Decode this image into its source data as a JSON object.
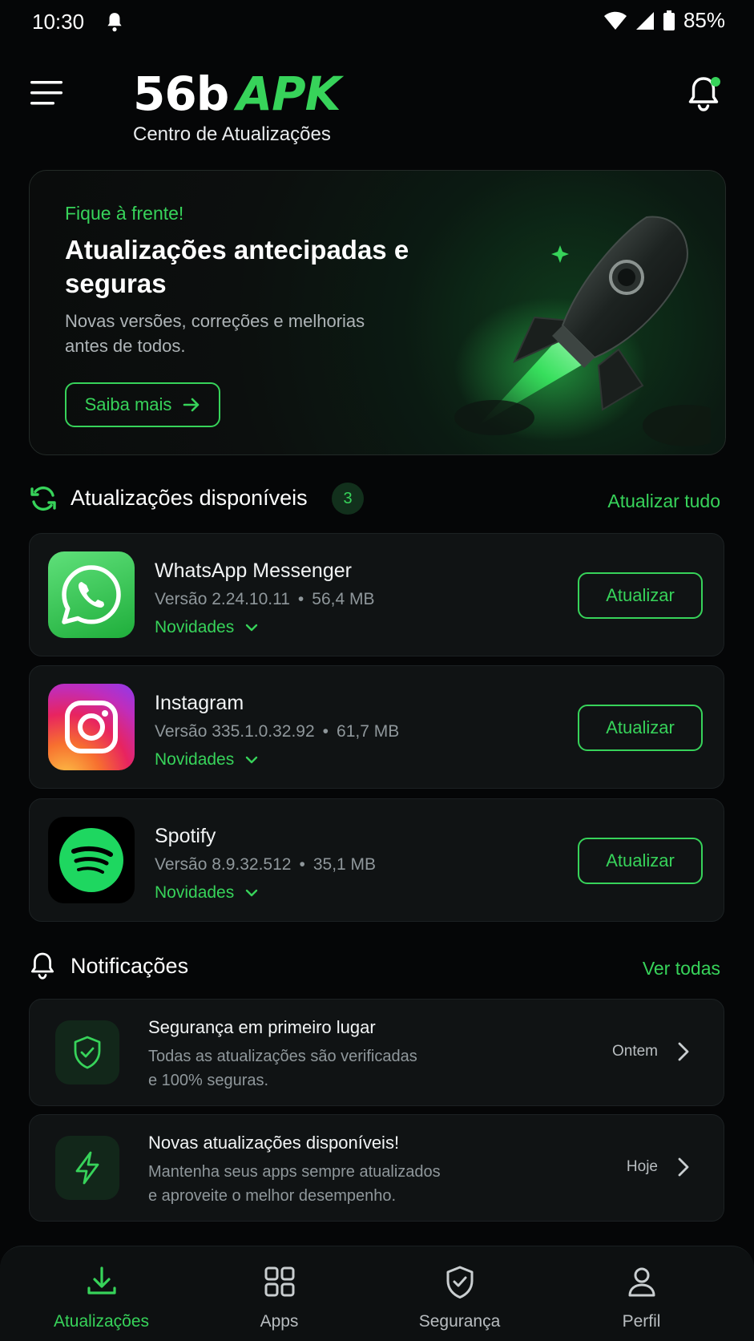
{
  "status_bar": {
    "time": "10:30",
    "battery": "85%"
  },
  "header": {
    "logo_main": "56b",
    "logo_accent": "APK",
    "subtitle": "Centro de Atualizações"
  },
  "hero": {
    "kicker": "Fique à frente!",
    "title": "Atualizações antecipadas e seguras",
    "description": "Novas versões, correções e melhorias antes de todos.",
    "button_label": "Saiba mais"
  },
  "updates_section": {
    "title": "Atualizações disponíveis",
    "count": "3",
    "action_label": "Atualizar tudo"
  },
  "apps": [
    {
      "name": "WhatsApp Messenger",
      "version": "Versão 2.24.10.11",
      "size": "56,4 MB",
      "news_label": "Novidades",
      "button_label": "Atualizar",
      "icon": "whatsapp-icon"
    },
    {
      "name": "Instagram",
      "version": "Versão 335.1.0.32.92",
      "size": "61,7 MB",
      "news_label": "Novidades",
      "button_label": "Atualizar",
      "icon": "instagram-icon"
    },
    {
      "name": "Spotify",
      "version": "Versão 8.9.32.512",
      "size": "35,1 MB",
      "news_label": "Novidades",
      "button_label": "Atualizar",
      "icon": "spotify-icon"
    }
  ],
  "notifications_section": {
    "title": "Notificações",
    "action_label": "Ver todas"
  },
  "notifications": [
    {
      "title": "Segurança em primeiro lugar",
      "desc_line1": "Todas as atualizações são verificadas",
      "desc_line2": "e 100% seguras.",
      "time": "Ontem",
      "icon": "shield-check-icon"
    },
    {
      "title": "Novas atualizações disponíveis!",
      "desc_line1": "Mantenha seus apps sempre atualizados",
      "desc_line2": "e aproveite o melhor desempenho.",
      "time": "Hoje",
      "icon": "lightning-icon"
    }
  ],
  "bottom_nav": [
    {
      "label": "Atualizações",
      "icon": "download-icon",
      "active": true
    },
    {
      "label": "Apps",
      "icon": "grid-icon",
      "active": false
    },
    {
      "label": "Segurança",
      "icon": "shield-check-icon",
      "active": false
    },
    {
      "label": "Perfil",
      "icon": "user-icon",
      "active": false
    }
  ],
  "colors": {
    "accent": "#37d35a",
    "background": "#050607",
    "card": "#101314"
  }
}
